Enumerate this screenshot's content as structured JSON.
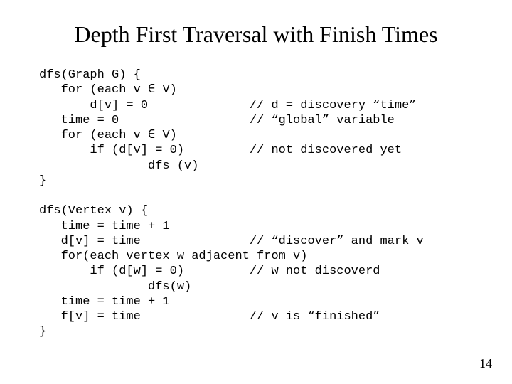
{
  "title": "Depth First Traversal with Finish Times",
  "code": "dfs(Graph G) {\n   for (each v ∈ V)\n       d[v] = 0              // d = discovery “time”\n   time = 0                  // “global” variable\n   for (each v ∈ V)\n       if (d[v] = 0)         // not discovered yet\n               dfs (v)\n}\n\ndfs(Vertex v) {\n   time = time + 1\n   d[v] = time               // “discover” and mark v\n   for(each vertex w adjacent from v)\n       if (d[w] = 0)         // w not discoverd\n               dfs(w)\n   time = time + 1\n   f[v] = time               // v is “finished”\n}",
  "page_number": "14"
}
